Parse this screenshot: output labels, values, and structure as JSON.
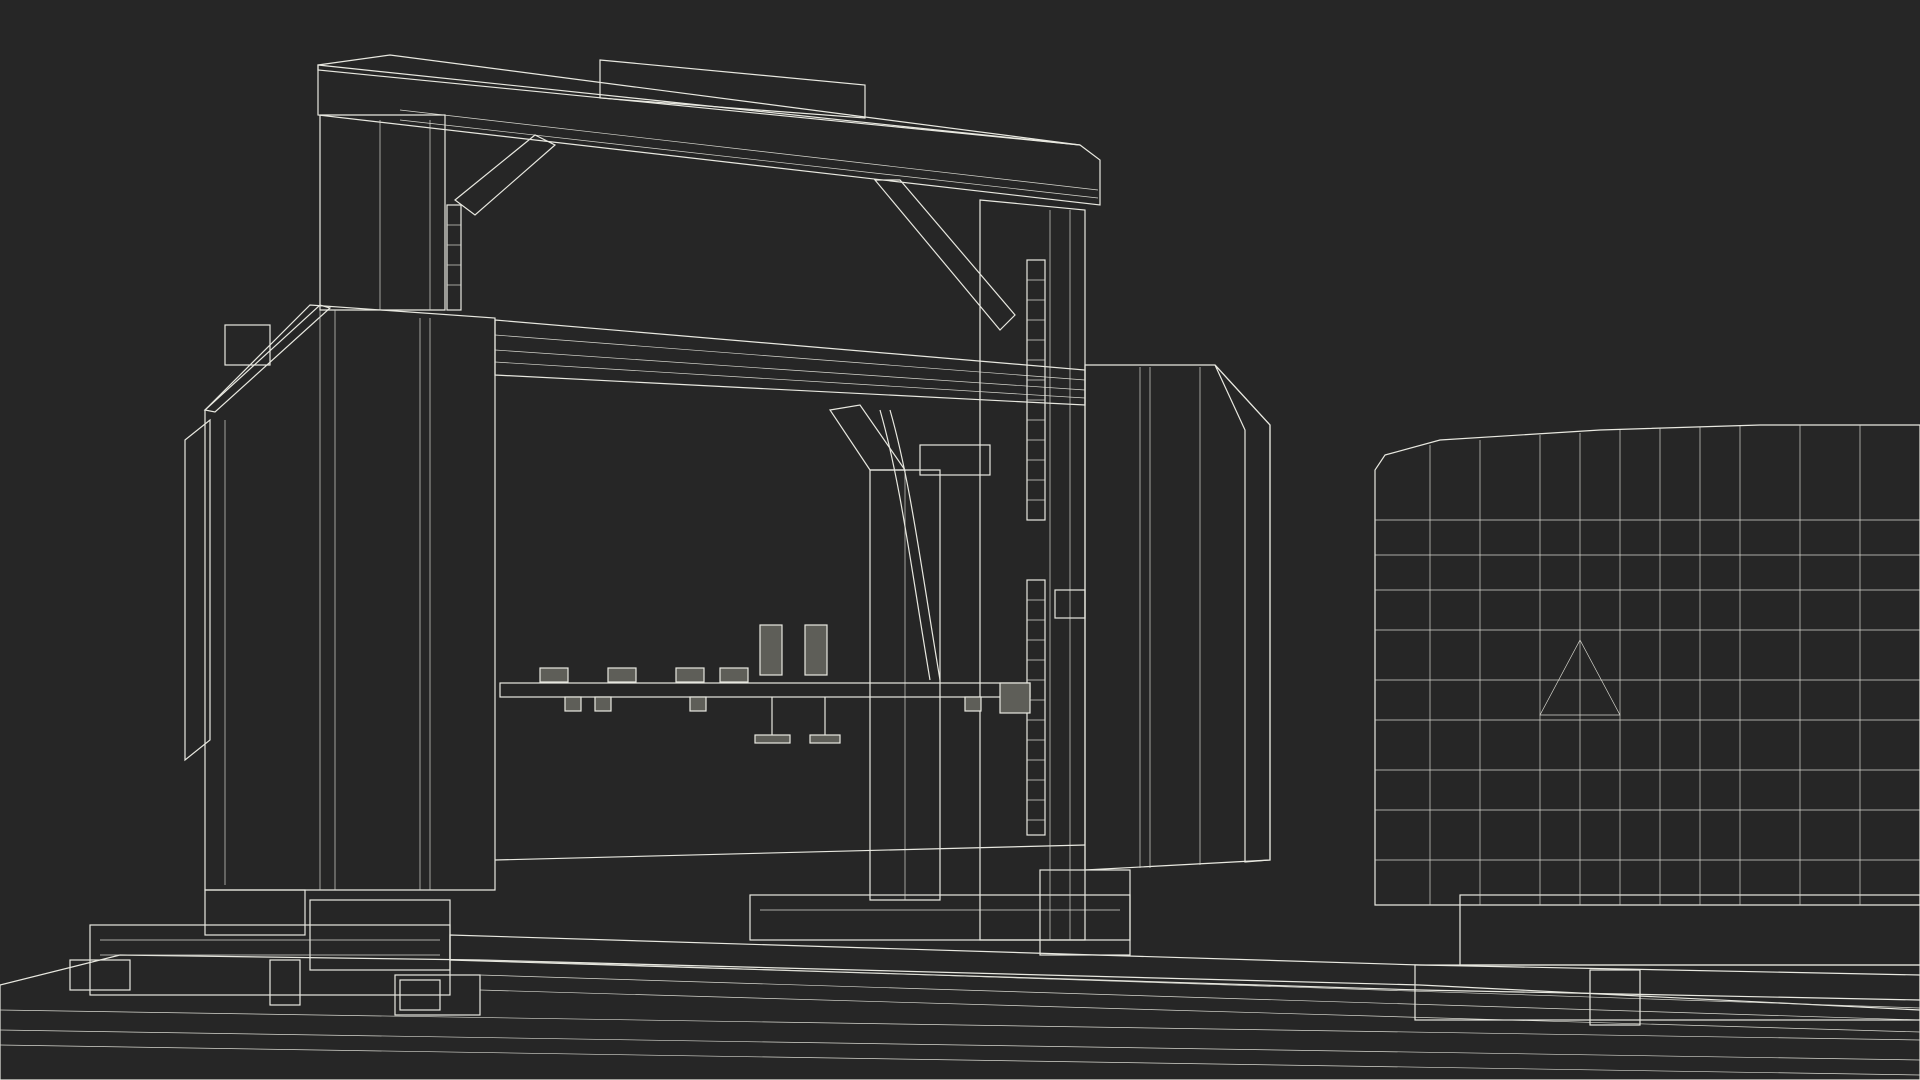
{
  "scene": {
    "description_visible_text": "",
    "background_color": "#262626",
    "object_fill_color": "#5e5e58",
    "wireframe_color": "#e8e8e0"
  }
}
